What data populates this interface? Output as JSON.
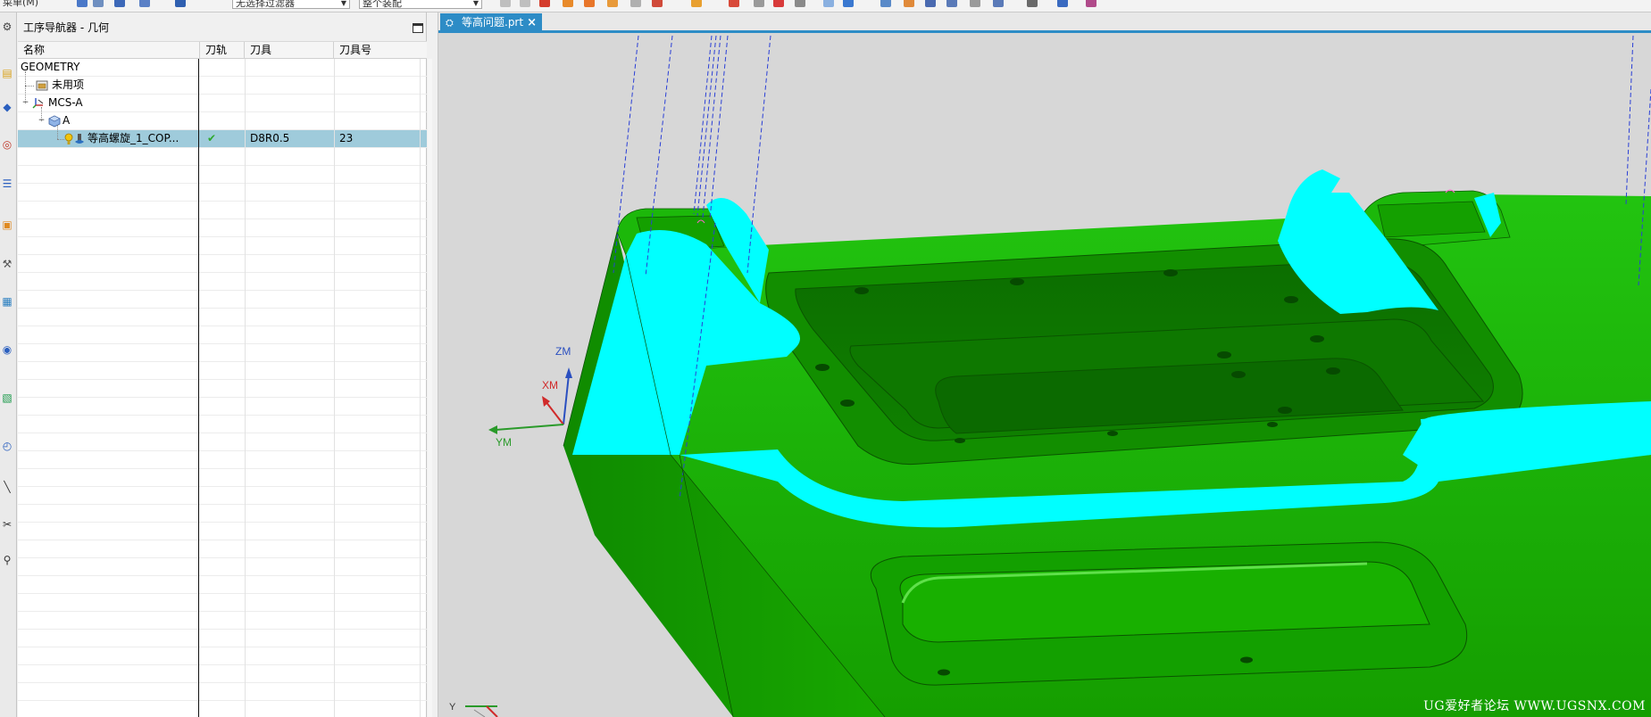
{
  "toolbar": {
    "menu_label": "菜单(M)",
    "filter_combo": "无选择过滤器",
    "scope_combo": "整个装配"
  },
  "navigator": {
    "title": "工序导航器 - 几何",
    "columns": [
      "名称",
      "刀轨",
      "刀具",
      "刀具号"
    ],
    "rows": [
      {
        "name": "GEOMETRY",
        "toolpath": "",
        "tool": "",
        "tool_no": ""
      },
      {
        "name": "未用项",
        "toolpath": "",
        "tool": "",
        "tool_no": ""
      },
      {
        "name": "MCS-A",
        "toolpath": "",
        "tool": "",
        "tool_no": ""
      },
      {
        "name": "A",
        "toolpath": "",
        "tool": "",
        "tool_no": ""
      },
      {
        "name": "等高螺旋_1_COP...",
        "toolpath": "✔",
        "tool": "D8R0.5",
        "tool_no": "23"
      }
    ]
  },
  "viewport": {
    "tab_label": "等高问题.prt",
    "axis_labels": {
      "zm": "ZM",
      "xm": "XM",
      "ym": "YM",
      "y": "Y"
    },
    "watermark": "UG爱好者论坛 WWW.UGSNX.COM"
  },
  "colors": {
    "part_green": "#17b000",
    "highlight_cyan": "#00ffff",
    "toolpath_blue": "#2a3fd6",
    "tab_blue": "#2d8cc6",
    "selection": "#9fcbdb",
    "check_green": "#2ea82e"
  }
}
